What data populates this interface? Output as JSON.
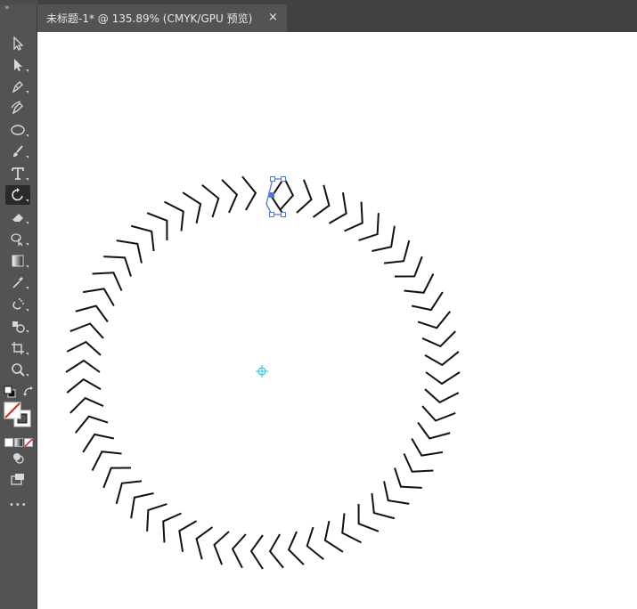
{
  "document_tab": {
    "title": "未标题-1* @ 135.89% (CMYK/GPU 预览)",
    "close_glyph": "×"
  },
  "toolbar": {
    "grip_glyph": "»",
    "more_glyph": "•••",
    "tools": [
      {
        "name": "selection-tool",
        "icon": "arrow-outline-icon"
      },
      {
        "name": "direct-selection-tool",
        "icon": "arrow-filled-icon"
      },
      {
        "name": "pen-tool",
        "icon": "pen-nib-icon"
      },
      {
        "name": "curvature-tool",
        "icon": "curvature-pen-icon"
      },
      {
        "name": "ellipse-tool",
        "icon": "ellipse-icon"
      },
      {
        "name": "paintbrush-tool",
        "icon": "brush-icon"
      },
      {
        "name": "type-tool",
        "icon": "type-T-icon"
      },
      {
        "name": "rotate-tool",
        "icon": "rotate-icon",
        "active": true
      },
      {
        "name": "eraser-tool",
        "icon": "eraser-icon"
      },
      {
        "name": "shape-builder-tool",
        "icon": "shape-builder-icon"
      },
      {
        "name": "gradient-tool",
        "icon": "gradient-icon"
      },
      {
        "name": "eyedropper-tool",
        "icon": "eyedropper-icon"
      },
      {
        "name": "symbol-sprayer-tool",
        "icon": "sprayer-icon"
      },
      {
        "name": "graph-tool",
        "icon": "chart-icon"
      },
      {
        "name": "artboard-tool",
        "icon": "artboard-icon"
      },
      {
        "name": "zoom-tool",
        "icon": "magnifier-icon"
      }
    ]
  },
  "colors": {
    "ui_dark": "#535353",
    "tab_bar": "#424242",
    "canvas": "#ffffff",
    "stroke": "#111111",
    "selection_blue": "#4d78d6",
    "fill_swatch": "#ffffff",
    "stroke_swatch": "#000000",
    "none_slash": "#e02020",
    "rotation_origin": "#2bc6d6"
  },
  "artwork": {
    "chevron_count": 60
  }
}
